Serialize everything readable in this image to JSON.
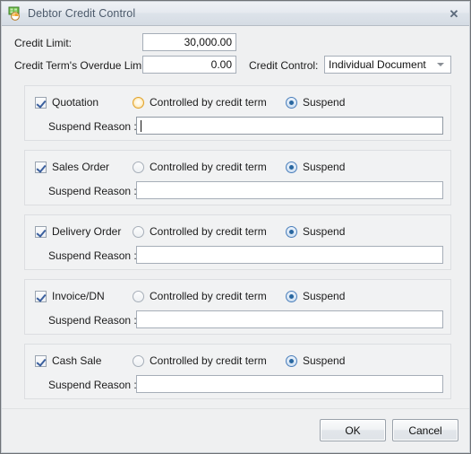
{
  "window": {
    "title": "Debtor Credit Control",
    "icon": "debtor-credit-icon",
    "close_label": "✕"
  },
  "header": {
    "credit_limit_label": "Credit Limit:",
    "credit_limit_value": "30,000.00",
    "overdue_limit_label": "Credit Term's Overdue Limit:",
    "overdue_limit_value": "0.00",
    "credit_control_label": "Credit Control:",
    "credit_control_value": "Individual Document",
    "credit_control_options": [
      "Individual Document"
    ]
  },
  "common": {
    "controlled_label": "Controlled by credit term",
    "suspend_label": "Suspend",
    "reason_label": "Suspend Reason :",
    "reason_placeholder": ""
  },
  "groups": [
    {
      "name": "Quotation",
      "checked": true,
      "mode": "suspend",
      "controlled_hot": true,
      "reason_value": "",
      "reason_focused": true
    },
    {
      "name": "Sales Order",
      "checked": true,
      "mode": "suspend",
      "controlled_hot": false,
      "reason_value": "",
      "reason_focused": false
    },
    {
      "name": "Delivery Order",
      "checked": true,
      "mode": "suspend",
      "controlled_hot": false,
      "reason_value": "",
      "reason_focused": false
    },
    {
      "name": "Invoice/DN",
      "checked": true,
      "mode": "suspend",
      "controlled_hot": false,
      "reason_value": "",
      "reason_focused": false
    },
    {
      "name": "Cash Sale",
      "checked": true,
      "mode": "suspend",
      "controlled_hot": false,
      "reason_value": "",
      "reason_focused": false
    }
  ],
  "footer": {
    "ok_label": "OK",
    "cancel_label": "Cancel"
  },
  "colors": {
    "accent_selected": "#28669f",
    "accent_hover": "#e0a12a",
    "titlebar_text": "#4c5a6b",
    "window_bg": "#eff0f1",
    "group_bg": "#f1f2f3"
  }
}
